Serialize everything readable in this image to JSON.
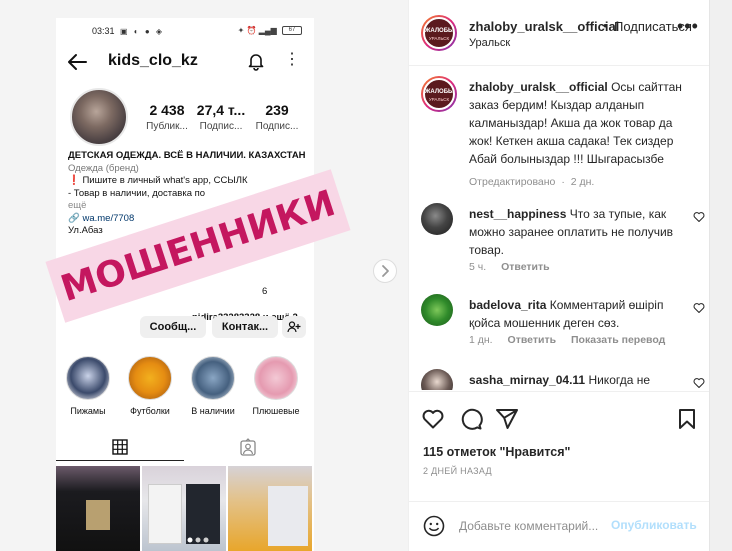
{
  "phone": {
    "status_time": "03:31",
    "status_icons": "▣ ◐ ● ◈",
    "status_right": "✦ ⏰ ▂▄▆",
    "battery": "67",
    "username": "kids_clo_kz",
    "stats": [
      {
        "number": "2 438",
        "label": "Публик..."
      },
      {
        "number": "27,4 т...",
        "label": "Подпис..."
      },
      {
        "number": "239",
        "label": "Подпис..."
      }
    ],
    "bio_title": "ДЕТСКАЯ ОДЕЖДА. ВСЁ В НАЛИЧИИ. КАЗАХСТАН",
    "bio_category": "Одежда (бренд)",
    "bio_line1": "❗ Пишите в личный what's app, ССЫЛК",
    "bio_line2": "- Товар в наличии, доставка по",
    "bio_more": "ещё",
    "bio_link": "🔗 wa.me/7708",
    "bio_address": "Ул.Абаз",
    "bio_phone_frag": "6",
    "bio_followers_frag": "nidira33283328 и ещё 2",
    "buttons": [
      "Сообщ...",
      "Контак..."
    ],
    "highlights": [
      "Пижамы",
      "Футболки",
      "В наличии",
      "Плюшевые"
    ]
  },
  "stamp_text": "МОШЕННИКИ",
  "header": {
    "username": "zhaloby_uralsk__official",
    "separator": "•",
    "follow_label": "Подписаться",
    "location": "Уральск",
    "avatar_text": "ЖАЛОБЫ",
    "avatar_subtext": "УРАЛЬСК"
  },
  "caption": {
    "username": "zhaloby_uralsk__official",
    "text": "Осы сайттан заказ бердим! Кыздар алданып калманыздар! Акша да жок товар да жок! Кеткен акша садака! Тек сиздер Абай болыныздар !!! Шыгарасызбе",
    "edited": "Отредактировано",
    "dot": "·",
    "time": "2 дн."
  },
  "comments": [
    {
      "username": "nest__happiness",
      "text": "Что за тупые, как можно заранее оплатить не получив товар.",
      "time": "5 ч.",
      "reply": "Ответить",
      "translate": ""
    },
    {
      "username": "badelova_rita",
      "text": "Комментарий өшіріп қойса мошенник деген сөз.",
      "time": "1 дн.",
      "reply": "Ответить",
      "translate": "Показать перевод"
    },
    {
      "username": "sasha_mirnay_04.11",
      "text": "Никогда не",
      "time": "",
      "reply": "",
      "translate": ""
    }
  ],
  "likes": "115 отметок \"Нравится\"",
  "date": "2 ДНЕЙ НАЗАД",
  "add_comment": {
    "placeholder": "Добавьте комментарий...",
    "publish": "Опубликовать"
  },
  "colors": {
    "stamp_bg": "#f8d7e6",
    "stamp_text": "#c4175f",
    "publish": "#b2dffc",
    "link": "#00376b",
    "muted": "#8e8e8e"
  }
}
